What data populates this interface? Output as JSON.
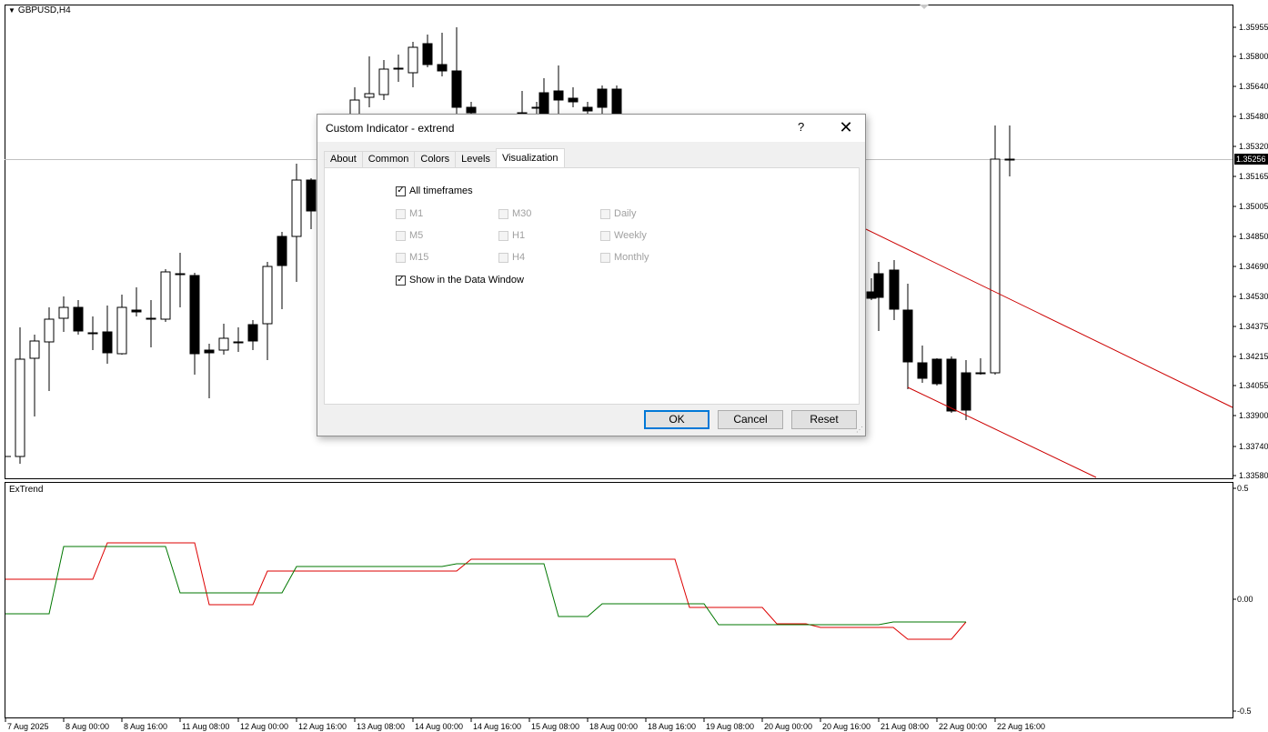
{
  "chart": {
    "symbol": "GBPUSD,H4",
    "indicator_label": "ExTrend",
    "current_price": "1.35256",
    "price_axis": [
      "1.35955",
      "1.35800",
      "1.35640",
      "1.35480",
      "1.35320",
      "1.35165",
      "1.35005",
      "1.34850",
      "1.34690",
      "1.34530",
      "1.34375",
      "1.34215",
      "1.34055",
      "1.33900",
      "1.33740",
      "1.33580"
    ],
    "indicator_axis": [
      "0.5",
      "0.00",
      "-0.5"
    ],
    "time_axis": [
      "7 Aug 2025",
      "8 Aug 00:00",
      "8 Aug 16:00",
      "11 Aug 08:00",
      "12 Aug 00:00",
      "12 Aug 16:00",
      "13 Aug 08:00",
      "14 Aug 00:00",
      "14 Aug 16:00",
      "15 Aug 08:00",
      "18 Aug 00:00",
      "18 Aug 16:00",
      "19 Aug 08:00",
      "20 Aug 00:00",
      "20 Aug 16:00",
      "21 Aug 08:00",
      "22 Aug 00:00",
      "22 Aug 16:00"
    ],
    "colors": {
      "bull_fill": "#ffffff",
      "bear_fill": "#000000",
      "channel": "#cc0000",
      "ind_red": "#dd0000",
      "ind_green": "#007700",
      "grid": "#c0c0c0"
    }
  },
  "dialog": {
    "title": "Custom Indicator - extrend",
    "help": "?",
    "close": "✕",
    "tabs": [
      {
        "label": "About"
      },
      {
        "label": "Common"
      },
      {
        "label": "Colors"
      },
      {
        "label": "Levels"
      },
      {
        "label": "Visualization",
        "active": true
      }
    ],
    "all_timeframes": {
      "label": "All timeframes",
      "checked": true
    },
    "timeframes": [
      {
        "label": "M1",
        "checked": false
      },
      {
        "label": "M5",
        "checked": false
      },
      {
        "label": "M15",
        "checked": false
      },
      {
        "label": "M30",
        "checked": false
      },
      {
        "label": "H1",
        "checked": false
      },
      {
        "label": "H4",
        "checked": false
      },
      {
        "label": "Daily",
        "checked": false
      },
      {
        "label": "Weekly",
        "checked": false
      },
      {
        "label": "Monthly",
        "checked": false
      }
    ],
    "show_data_window": {
      "label": "Show in the Data Window",
      "checked": true
    },
    "buttons": {
      "ok": "OK",
      "cancel": "Cancel",
      "reset": "Reset"
    }
  }
}
